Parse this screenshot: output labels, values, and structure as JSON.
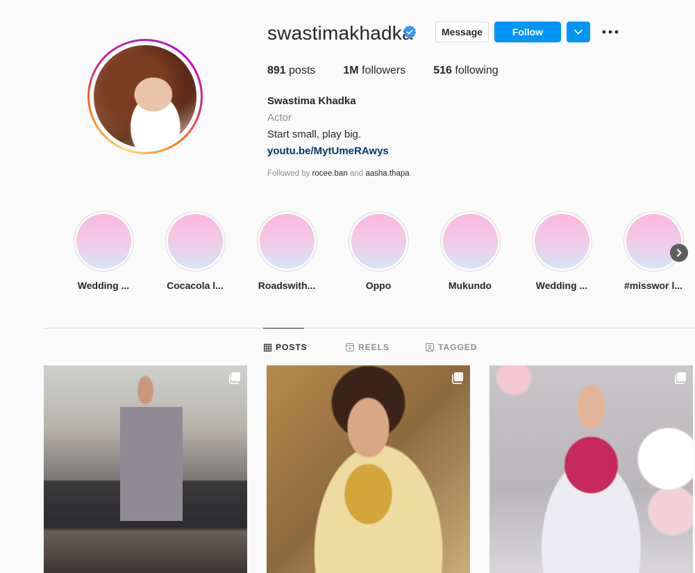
{
  "profile": {
    "username": "swastimakhadka",
    "verified": true,
    "buttons": {
      "message": "Message",
      "follow": "Follow"
    },
    "stats": [
      {
        "value": "891",
        "label": "posts"
      },
      {
        "value": "1M",
        "label": "followers"
      },
      {
        "value": "516",
        "label": "following"
      }
    ],
    "full_name": "Swastima Khadka",
    "category": "Actor",
    "bio": "Start small, play big.",
    "link": "youtu.be/MytUmeRAwys",
    "followed_by_prefix": "Followed by",
    "followed_by_user1": "rocee.ban",
    "followed_by_and": "and",
    "followed_by_user2": "aasha.thapa"
  },
  "highlights": [
    {
      "label": "Wedding ..."
    },
    {
      "label": "Cocacola l..."
    },
    {
      "label": "Roadswith..."
    },
    {
      "label": "Oppo"
    },
    {
      "label": "Mukundo"
    },
    {
      "label": "Wedding ..."
    },
    {
      "label": "#misswor l..."
    }
  ],
  "tabs": [
    {
      "label": "POSTS",
      "icon": "grid-icon",
      "active": true
    },
    {
      "label": "REELS",
      "icon": "reels-icon",
      "active": false
    },
    {
      "label": "TAGGED",
      "icon": "tagged-icon",
      "active": false
    }
  ],
  "posts": [
    {
      "type": "multiple"
    },
    {
      "type": "multiple"
    },
    {
      "type": "multiple"
    }
  ],
  "colors": {
    "accent": "#0095f6",
    "link": "#00376b",
    "muted": "#8e8e8e",
    "verified": "#3897f0"
  }
}
